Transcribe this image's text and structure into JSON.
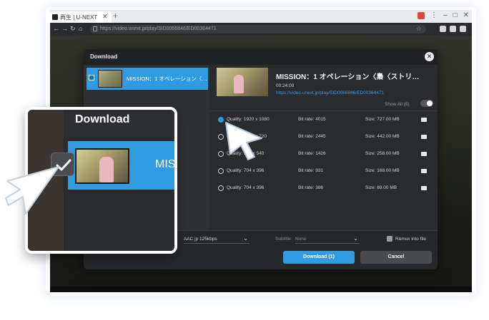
{
  "browser": {
    "tab_title": "再生 | U-NEXT",
    "new_tab": "+",
    "url": "https://video.unext.jp/play/SID0066846/ED00364471",
    "window_controls": [
      "gift-icon",
      "minimize-icon",
      "maximize-icon",
      "close-icon"
    ]
  },
  "dialog": {
    "title": "Download",
    "close_glyph": "✕",
    "list_item_label": "MISSION：1 オペレーション〈…",
    "video": {
      "title": "MISSION：1 オペレーション〈梟〈ストリ…",
      "duration": "00:24:09",
      "url": "https://video.unext.jp/play/SID0066846/ED00364471"
    },
    "show_all": "Show All (6)",
    "qualities": [
      {
        "quality": "Quality: 1920 x 1080",
        "bitrate": "Bit rate: 4015",
        "size": "Size: 727.00 MB",
        "selected": true
      },
      {
        "quality": "Quality: 1280 x 720",
        "bitrate": "Bit rate: 2445",
        "size": "Size: 442.00 MB",
        "selected": false
      },
      {
        "quality": "Quality: 960 x 540",
        "bitrate": "Bit rate: 1426",
        "size": "Size: 258.00 MB",
        "selected": false
      },
      {
        "quality": "Quality: 704 x 396",
        "bitrate": "Bit rate: 931",
        "size": "Size: 168.00 MB",
        "selected": false
      },
      {
        "quality": "Quality: 704 x 396",
        "bitrate": "Bit rate: 386",
        "size": "Size: 69.00 MB",
        "selected": false
      }
    ],
    "audio_value": "AAC jp 125kbps",
    "subtitle_label": "Subtitle:",
    "subtitle_value": "None",
    "remux_label": "Remux into file",
    "download_button": "Download (1)",
    "cancel_button": "Cancel"
  },
  "zoom": {
    "title": "Download",
    "item_label": "MISS"
  },
  "colors": {
    "accent": "#2f9be0",
    "dialog_bg": "#27282b"
  }
}
